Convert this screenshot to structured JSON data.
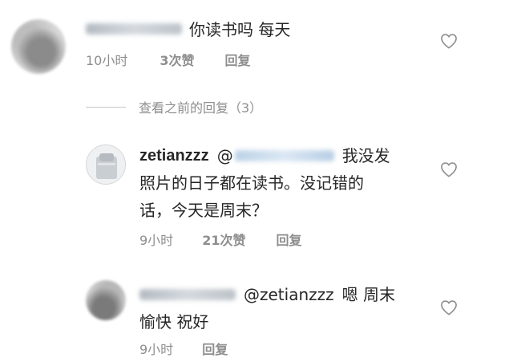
{
  "comments": [
    {
      "text": "你读书吗 每天",
      "time": "10小时",
      "likes": "3次赞",
      "reply": "回复"
    },
    {
      "username": "zetianzzz",
      "mention": "@",
      "text_line1": "我没发",
      "text_line2": "照片的日子都在读书。没记错的",
      "text_line3": "话，今天是周末？",
      "time": "9小时",
      "likes": "21次赞",
      "reply": "回复"
    },
    {
      "mention": "@zetianzzz",
      "text_line1": "嗯 周末",
      "text_line2": "愉快 祝好",
      "time": "9小时",
      "reply": "回复"
    }
  ],
  "view_previous_replies": "查看之前的回复（3）",
  "icons": {
    "like": "heart-outline-icon"
  },
  "colors": {
    "text": "#262626",
    "muted": "#8e8e8e",
    "divider": "#c7c7c7"
  }
}
